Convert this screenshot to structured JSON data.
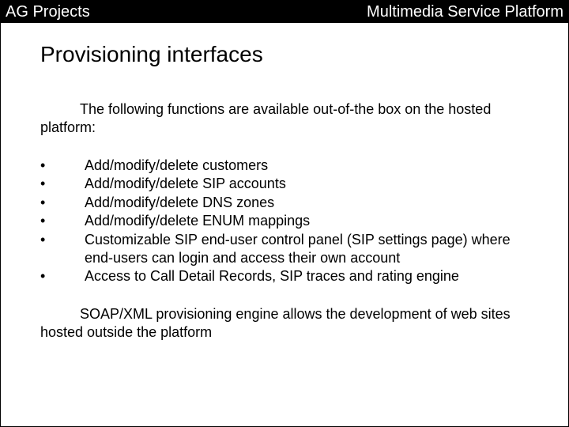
{
  "header": {
    "left": "AG Projects",
    "right": "Multimedia Service Platform"
  },
  "title": "Provisioning interfaces",
  "intro": "The following functions are available out-of-the box on the hosted platform:",
  "bullets": [
    "Add/modify/delete customers",
    "Add/modify/delete SIP accounts",
    "Add/modify/delete DNS zones",
    "Add/modify/delete ENUM mappings",
    "Customizable SIP end-user control panel (SIP settings page) where end-users can login and access their own account",
    "Access to Call Detail Records, SIP traces and rating engine"
  ],
  "closing": "SOAP/XML provisioning engine allows the development of web sites hosted outside the platform",
  "bullet_char": "•"
}
